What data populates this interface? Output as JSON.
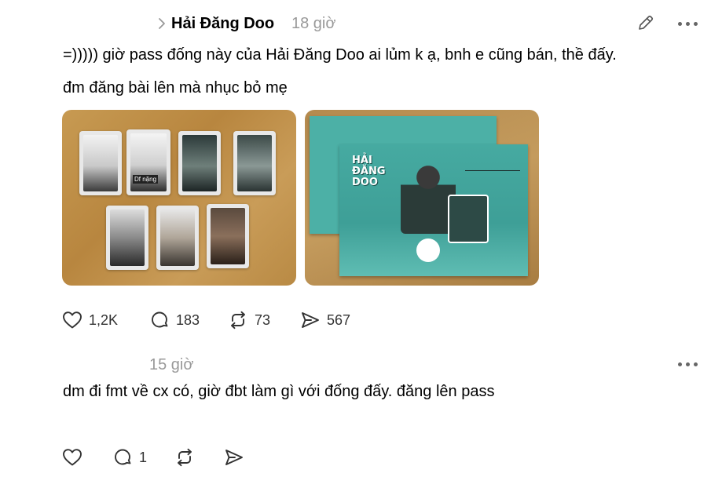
{
  "post": {
    "author": "Hải Đăng Doo",
    "time": "18 giờ",
    "text_line1": "=))))) giờ pass đống này của Hải Đăng Doo ai lủm k ạ, bnh e cũng bán, thề đấy.",
    "text_line2": "đm đăng bài lên mà nhục bỏ mẹ",
    "photo2_overlay": "HẢI ĐĂNG DOO",
    "photo1_card_label": "Df nặng",
    "actions": {
      "likes": "1,2K",
      "comments": "183",
      "reposts": "73",
      "shares": "567"
    }
  },
  "reply": {
    "time": "15 giờ",
    "text": "dm đi fmt về cx có, giờ đbt làm gì với đống đấy. đăng lên pass",
    "actions": {
      "comments": "1"
    }
  },
  "colors": {
    "muted": "#999999",
    "icon": "#333333",
    "poster_teal": "#48a9a0"
  }
}
